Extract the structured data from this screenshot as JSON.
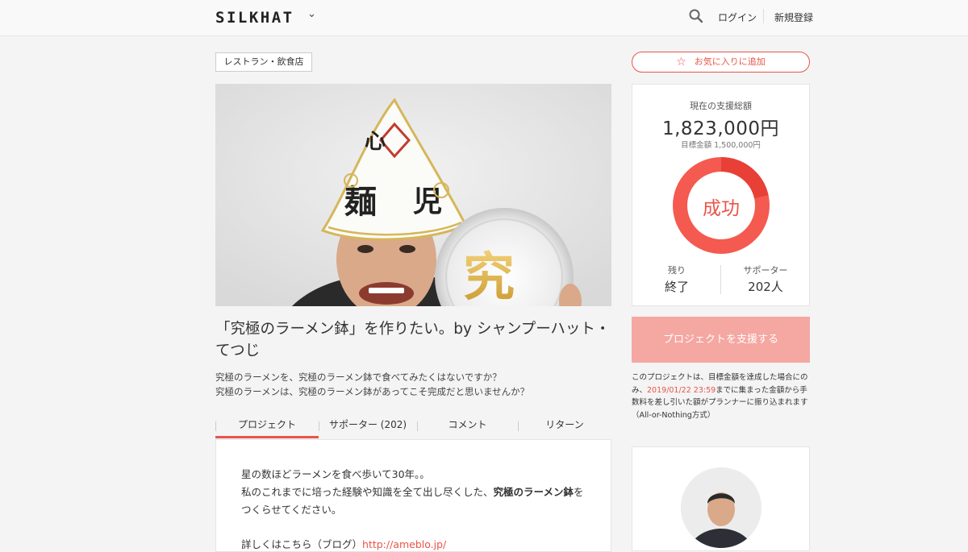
{
  "header": {
    "logo": "SILKHAT",
    "logo_chevron": "⌄",
    "login": "ログイン",
    "signup": "新規登録"
  },
  "project": {
    "category": "レストラン・飲食店",
    "title": "「究極のラーメン鉢」を作りたい。by シャンプーハット・てつじ",
    "desc_lines": [
      "究極のラーメンを、究極のラーメン鉢で食べてみたくはないですか？",
      "究極のラーメンは、究極のラーメン鉢があってこそ完成だと思いませんか？"
    ]
  },
  "tabs": [
    {
      "label": "プロジェクト",
      "active": true
    },
    {
      "label": "サポーター (202)",
      "active": false
    },
    {
      "label": "コメント",
      "active": false
    },
    {
      "label": "リターン",
      "active": false
    }
  ],
  "body": {
    "line1": "星の数ほどラーメンを食べ歩いて30年。。",
    "line2_pre": "私のこれまでに培った経験や知識を全て出し尽くした、",
    "line2_strong": "究極のラーメン鉢",
    "line2_post": "を",
    "line3": "つくらせてください。",
    "cut_text": "詳しくはこちら（ブログ）",
    "cut_link": "http://ameblo.jp/"
  },
  "sidebar": {
    "favorite": "お気に入りに追加",
    "funding_label": "現在の支援総額",
    "funding_amount": "1,823,000円",
    "target": "目標金額 1,500,000円",
    "status": "成功",
    "progress_percent": 121.5,
    "remaining_label": "残り",
    "remaining_value": "終了",
    "supporters_label": "サポーター",
    "supporters_value": "202人",
    "support_button": "プロジェクトを支援する",
    "note_pre": "このプロジェクトは、目標金額を達成した場合にのみ、",
    "note_date": "2019/01/22 23:59",
    "note_post": "までに集まった金額から手数料を差し引いた額がプランナーに振り込まれます（All-or-Nothing方式）"
  },
  "colors": {
    "accent": "#e95449",
    "accent_light": "#f5a7a2",
    "background": "#f4f4f4"
  }
}
